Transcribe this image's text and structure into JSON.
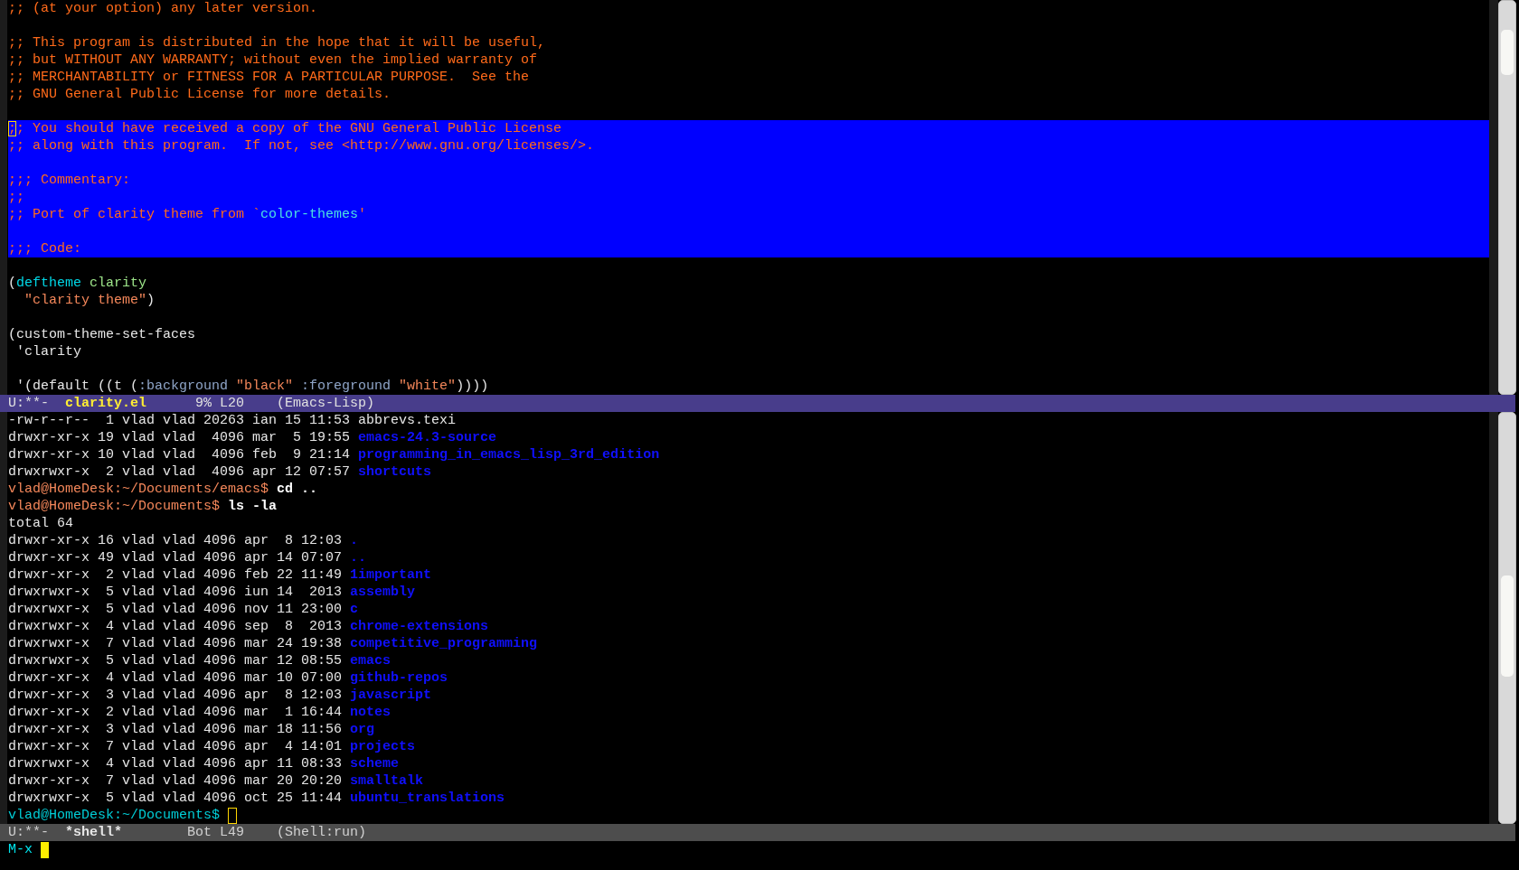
{
  "editor": {
    "lines": [
      {
        "highlighted": false,
        "segments": [
          {
            "text": ";; (at your option) any later version.",
            "kind": "comment"
          }
        ]
      },
      {
        "highlighted": false
      },
      {
        "highlighted": false,
        "segments": [
          {
            "text": ";; This program is distributed in the hope that it will be useful,",
            "kind": "comment"
          }
        ]
      },
      {
        "highlighted": false,
        "segments": [
          {
            "text": ";; but WITHOUT ANY WARRANTY; without even the implied warranty of",
            "kind": "comment"
          }
        ]
      },
      {
        "highlighted": false,
        "segments": [
          {
            "text": ";; MERCHANTABILITY or FITNESS FOR A PARTICULAR PURPOSE.  See the",
            "kind": "comment"
          }
        ]
      },
      {
        "highlighted": false,
        "segments": [
          {
            "text": ";; GNU General Public License for more details.",
            "kind": "comment"
          }
        ]
      },
      {
        "highlighted": false
      },
      {
        "highlighted": true,
        "segments": [
          {
            "text": ";",
            "kind": "comment",
            "cursor": true
          },
          {
            "text": "; You should have received a copy of the GNU General Public License",
            "kind": "comment"
          }
        ]
      },
      {
        "highlighted": true,
        "segments": [
          {
            "text": ";; along with this program.  If not, see <http://www.gnu.org/licenses/>.",
            "kind": "comment"
          }
        ]
      },
      {
        "highlighted": true
      },
      {
        "highlighted": true,
        "segments": [
          {
            "text": ";;; Commentary:",
            "kind": "comment"
          }
        ]
      },
      {
        "highlighted": true,
        "segments": [
          {
            "text": ";;",
            "kind": "comment"
          }
        ]
      },
      {
        "highlighted": true,
        "segments": [
          {
            "text": ";; Port of clarity theme from `",
            "kind": "comment"
          },
          {
            "text": "color-themes",
            "kind": "constant"
          },
          {
            "text": "'",
            "kind": "comment"
          }
        ]
      },
      {
        "highlighted": true
      },
      {
        "highlighted": true,
        "segments": [
          {
            "text": ";;; Code:",
            "kind": "comment"
          }
        ]
      },
      {
        "highlighted": false
      },
      {
        "highlighted": false,
        "segments": [
          {
            "text": "(",
            "kind": "plain"
          },
          {
            "text": "deftheme",
            "kind": "keyword"
          },
          {
            "text": " clarity",
            "kind": "function"
          }
        ]
      },
      {
        "highlighted": false,
        "segments": [
          {
            "text": "  \"clarity theme\"",
            "kind": "string"
          },
          {
            "text": ")",
            "kind": "plain"
          }
        ]
      },
      {
        "highlighted": false
      },
      {
        "highlighted": false,
        "segments": [
          {
            "text": "(custom-theme-set-faces",
            "kind": "plain"
          }
        ]
      },
      {
        "highlighted": false,
        "segments": [
          {
            "text": " 'clarity",
            "kind": "plain"
          }
        ]
      },
      {
        "highlighted": false
      },
      {
        "highlighted": false,
        "segments": [
          {
            "text": " '(default ((t (",
            "kind": "plain"
          },
          {
            "text": ":background",
            "kind": "builtin"
          },
          {
            "text": " \"black\"",
            "kind": "string"
          },
          {
            "text": " :foreground",
            "kind": "builtin"
          },
          {
            "text": " \"white\"",
            "kind": "string"
          },
          {
            "text": "))))",
            "kind": "plain"
          }
        ]
      }
    ]
  },
  "editor_mode_line": {
    "selected": true,
    "status": "U:**-",
    "buffer": "clarity.el",
    "position": "9% L20",
    "mode": "(Emacs-Lisp)"
  },
  "shell": {
    "lines": [
      {
        "segments": [
          {
            "text": "-rw-r--r--  1 vlad vlad 20263 ian 15 11:53 abbrevs.texi",
            "kind": "plain"
          }
        ]
      },
      {
        "segments": [
          {
            "text": "drwxr-xr-x 19 vlad vlad  4096 mar  5 19:55 ",
            "kind": "plain"
          },
          {
            "text": "emacs-24.3-source",
            "kind": "directory"
          }
        ]
      },
      {
        "segments": [
          {
            "text": "drwxr-xr-x 10 vlad vlad  4096 feb  9 21:14 ",
            "kind": "plain"
          },
          {
            "text": "programming_in_emacs_lisp_3rd_edition",
            "kind": "directory"
          }
        ]
      },
      {
        "segments": [
          {
            "text": "drwxrwxr-x  2 vlad vlad  4096 apr 12 07:57 ",
            "kind": "plain"
          },
          {
            "text": "shortcuts",
            "kind": "directory"
          }
        ]
      },
      {
        "segments": [
          {
            "text": "vlad@HomeDesk:~/Documents/emacs$ ",
            "kind": "prompt"
          },
          {
            "text": "cd ..",
            "kind": "command"
          }
        ]
      },
      {
        "segments": [
          {
            "text": "vlad@HomeDesk:~/Documents$ ",
            "kind": "prompt"
          },
          {
            "text": "ls -la",
            "kind": "command"
          }
        ]
      },
      {
        "segments": [
          {
            "text": "total 64",
            "kind": "plain"
          }
        ]
      },
      {
        "segments": [
          {
            "text": "drwxr-xr-x 16 vlad vlad 4096 apr  8 12:03 ",
            "kind": "plain"
          },
          {
            "text": ".",
            "kind": "directory"
          }
        ]
      },
      {
        "segments": [
          {
            "text": "drwxr-xr-x 49 vlad vlad 4096 apr 14 07:07 ",
            "kind": "plain"
          },
          {
            "text": "..",
            "kind": "directory"
          }
        ]
      },
      {
        "segments": [
          {
            "text": "drwxr-xr-x  2 vlad vlad 4096 feb 22 11:49 ",
            "kind": "plain"
          },
          {
            "text": "1important",
            "kind": "directory"
          }
        ]
      },
      {
        "segments": [
          {
            "text": "drwxrwxr-x  5 vlad vlad 4096 iun 14  2013 ",
            "kind": "plain"
          },
          {
            "text": "assembly",
            "kind": "directory"
          }
        ]
      },
      {
        "segments": [
          {
            "text": "drwxrwxr-x  5 vlad vlad 4096 nov 11 23:00 ",
            "kind": "plain"
          },
          {
            "text": "c",
            "kind": "directory"
          }
        ]
      },
      {
        "segments": [
          {
            "text": "drwxrwxr-x  4 vlad vlad 4096 sep  8  2013 ",
            "kind": "plain"
          },
          {
            "text": "chrome-extensions",
            "kind": "directory"
          }
        ]
      },
      {
        "segments": [
          {
            "text": "drwxrwxr-x  7 vlad vlad 4096 mar 24 19:38 ",
            "kind": "plain"
          },
          {
            "text": "competitive_programming",
            "kind": "directory"
          }
        ]
      },
      {
        "segments": [
          {
            "text": "drwxrwxr-x  5 vlad vlad 4096 mar 12 08:55 ",
            "kind": "plain"
          },
          {
            "text": "emacs",
            "kind": "directory"
          }
        ]
      },
      {
        "segments": [
          {
            "text": "drwxr-xr-x  4 vlad vlad 4096 mar 10 07:00 ",
            "kind": "plain"
          },
          {
            "text": "github-repos",
            "kind": "directory"
          }
        ]
      },
      {
        "segments": [
          {
            "text": "drwxr-xr-x  3 vlad vlad 4096 apr  8 12:03 ",
            "kind": "plain"
          },
          {
            "text": "javascript",
            "kind": "directory"
          }
        ]
      },
      {
        "segments": [
          {
            "text": "drwxr-xr-x  2 vlad vlad 4096 mar  1 16:44 ",
            "kind": "plain"
          },
          {
            "text": "notes",
            "kind": "directory"
          }
        ]
      },
      {
        "segments": [
          {
            "text": "drwxr-xr-x  3 vlad vlad 4096 mar 18 11:56 ",
            "kind": "plain"
          },
          {
            "text": "org",
            "kind": "directory"
          }
        ]
      },
      {
        "segments": [
          {
            "text": "drwxr-xr-x  7 vlad vlad 4096 apr  4 14:01 ",
            "kind": "plain"
          },
          {
            "text": "projects",
            "kind": "directory"
          }
        ]
      },
      {
        "segments": [
          {
            "text": "drwxrwxr-x  4 vlad vlad 4096 apr 11 08:33 ",
            "kind": "plain"
          },
          {
            "text": "scheme",
            "kind": "directory"
          }
        ]
      },
      {
        "segments": [
          {
            "text": "drwxr-xr-x  7 vlad vlad 4096 mar 20 20:20 ",
            "kind": "plain"
          },
          {
            "text": "smalltalk",
            "kind": "directory"
          }
        ]
      },
      {
        "segments": [
          {
            "text": "drwxrwxr-x  5 vlad vlad 4096 oct 25 11:44 ",
            "kind": "plain"
          },
          {
            "text": "ubuntu_translations",
            "kind": "directory"
          }
        ]
      },
      {
        "segments": [
          {
            "text": "vlad@HomeDesk:~/Documents$",
            "kind": "prompt_current"
          }
        ],
        "cursor_after": true
      }
    ]
  },
  "shell_mode_line": {
    "selected": false,
    "status": "U:**-",
    "buffer": "*shell*",
    "position": "Bot L49",
    "mode": "(Shell:run)"
  },
  "minibuffer": {
    "prompt": "M-x",
    "cursor": true
  }
}
